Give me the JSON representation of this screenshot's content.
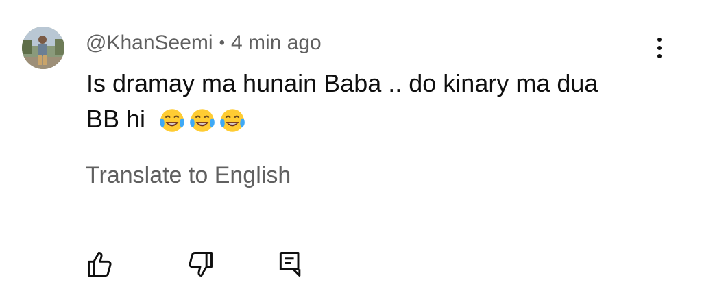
{
  "comment": {
    "author": "@KhanSeemi",
    "separator": "•",
    "time": "4 min ago",
    "text_line1": "Is dramay ma hunain Baba .. do kinary ma dua",
    "text_line2": "BB hi",
    "emojis": [
      "face-with-tears-of-joy-icon",
      "face-with-tears-of-joy-icon",
      "face-with-tears-of-joy-icon"
    ],
    "translate_label": "Translate to English"
  },
  "actions": {
    "like_icon": "thumbs-up-icon",
    "dislike_icon": "thumbs-down-icon",
    "reply_icon": "reply-comment-icon",
    "menu_icon": "more-vertical-icon"
  },
  "colors": {
    "primary_text": "#0f0f0f",
    "secondary_text": "#606060",
    "background": "#ffffff"
  }
}
